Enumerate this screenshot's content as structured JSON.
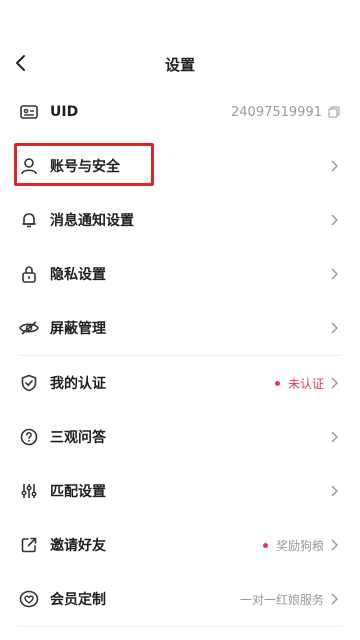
{
  "header": {
    "title": "设置"
  },
  "uid": {
    "label": "UID",
    "value": "24097519991"
  },
  "items": [
    {
      "label": "账号与安全"
    },
    {
      "label": "消息通知设置"
    },
    {
      "label": "隐私设置"
    },
    {
      "label": "屏蔽管理"
    },
    {
      "label": "我的认证",
      "status": "未认证"
    },
    {
      "label": "三观问答"
    },
    {
      "label": "匹配设置"
    },
    {
      "label": "邀请好友",
      "status": "奖励狗粮"
    },
    {
      "label": "会员定制",
      "status": "一对一红娘服务"
    }
  ],
  "colors": {
    "accent_red": "#e53a5c",
    "highlight": "#d92727"
  },
  "icons": [
    "back-icon",
    "id-card-icon",
    "copy-icon",
    "person-icon",
    "bell-icon",
    "lock-icon",
    "eye-off-icon",
    "shield-check-icon",
    "question-icon",
    "sliders-icon",
    "share-icon",
    "heart-icon",
    "chevron-right-icon"
  ]
}
